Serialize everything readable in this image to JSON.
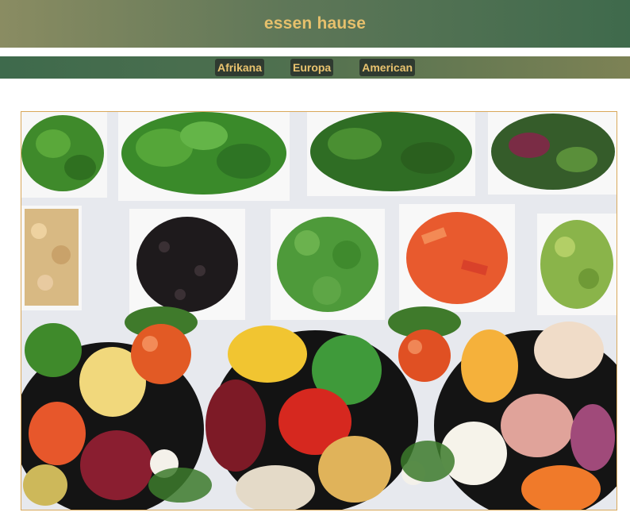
{
  "header": {
    "title": "essen hause"
  },
  "nav": {
    "items": [
      {
        "label": "Afrikana"
      },
      {
        "label": "Europa"
      },
      {
        "label": "American"
      }
    ]
  },
  "hero": {
    "image_subject": "salad-bar-vegetables-in-bowls",
    "frame_color": "#d9a85a"
  },
  "colors": {
    "header_gradient": [
      "#8a8c62",
      "#3f6a4c"
    ],
    "title_text": "#e6c06c",
    "nav_button_bg": "#2f3a30",
    "nav_button_text": "#e9c36f"
  }
}
